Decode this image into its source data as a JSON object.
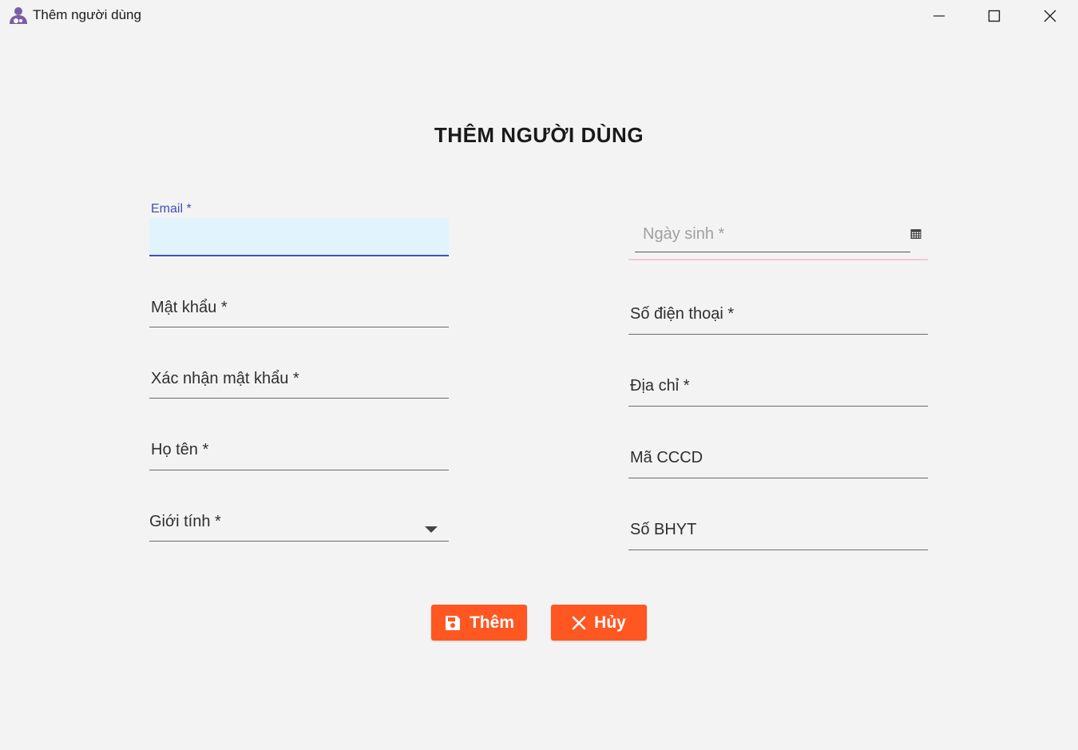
{
  "window": {
    "title": "Thêm người dùng",
    "app_icon": "user-icon"
  },
  "form": {
    "heading": "THÊM NGƯỜI DÙNG",
    "left_fields": {
      "email": {
        "label": "Email *",
        "value": ""
      },
      "password": {
        "label": "Mật khẩu *",
        "value": ""
      },
      "confirm_password": {
        "label": "Xác nhận mật khẩu *",
        "value": ""
      },
      "full_name": {
        "label": "Họ tên *",
        "value": ""
      },
      "gender": {
        "label": "Giới tính *",
        "value": ""
      }
    },
    "right_fields": {
      "birth_date": {
        "label": "Ngày sinh *",
        "value": "",
        "icon": "calendar-icon"
      },
      "phone": {
        "label": "Số điện thoại *",
        "value": ""
      },
      "address": {
        "label": "Địa chỉ *",
        "value": ""
      },
      "cccd": {
        "label": "Mã CCCD",
        "value": ""
      },
      "bhyt": {
        "label": "Số BHYT",
        "value": ""
      }
    }
  },
  "actions": {
    "add": {
      "label": "Thêm",
      "icon": "save-icon"
    },
    "cancel": {
      "label": "Hủy",
      "icon": "close-icon"
    }
  },
  "colors": {
    "accent": "#3f51b5",
    "button": "#ff5722",
    "focus_fill": "#e1f3fc",
    "error_underline": "#f7c8d0",
    "app_icon": "#7b5ea7"
  }
}
